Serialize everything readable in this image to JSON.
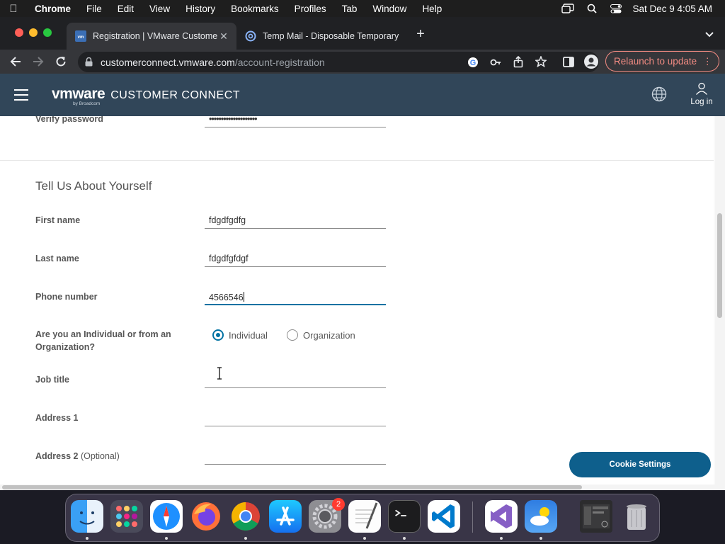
{
  "menubar": {
    "items": [
      "Chrome",
      "File",
      "Edit",
      "View",
      "History",
      "Bookmarks",
      "Profiles",
      "Tab",
      "Window",
      "Help"
    ],
    "clock": "Sat Dec 9  4:05 AM"
  },
  "browser": {
    "tabs": [
      {
        "title": "Registration | VMware Customer Connect",
        "favicon": "vmware-favicon",
        "active": true
      },
      {
        "title": "Temp Mail - Disposable Temporary Email",
        "favicon": "temp-mail-favicon",
        "active": false
      }
    ],
    "url_host": "customerconnect.vmware.com",
    "url_path": "/account-registration",
    "relaunch_label": "Relaunch to update"
  },
  "header": {
    "logo_vm": "vmware",
    "brand": "CUSTOMER CONNECT",
    "logo_by": "by Broadcom",
    "login_label": "Log in"
  },
  "form": {
    "verify_password": {
      "label": "Verify password",
      "value": "••••••••••••••••••••"
    },
    "section_title": "Tell Us About Yourself",
    "first_name": {
      "label": "First name",
      "value": "fdgdfgdfg"
    },
    "last_name": {
      "label": "Last name",
      "value": "fdgdfgfdgf"
    },
    "phone": {
      "label": "Phone number",
      "value": "4566546"
    },
    "org_question": {
      "line1": "Are you an Individual or from an",
      "line2": "Organization?"
    },
    "options": [
      {
        "label": "Individual",
        "checked": true
      },
      {
        "label": "Organization",
        "checked": false
      }
    ],
    "job_title": {
      "label": "Job title",
      "value": ""
    },
    "address1": {
      "label": "Address 1",
      "value": ""
    },
    "address2": {
      "label": "Address 2",
      "optional": "(Optional)",
      "value": ""
    }
  },
  "cookie_button": "Cookie Settings",
  "dock": {
    "apps": [
      "finder",
      "launchpad",
      "safari",
      "firefox",
      "chrome",
      "app-store",
      "system-settings",
      "textedit",
      "terminal",
      "vscode",
      "visual-studio",
      "weather",
      "screenshot",
      "trash"
    ],
    "settings_badge": "2"
  },
  "colors": {
    "header_bg": "#314659",
    "accent": "#0072a3",
    "cookie_bg": "#0e5f8c",
    "relaunch": "#f28b82"
  }
}
